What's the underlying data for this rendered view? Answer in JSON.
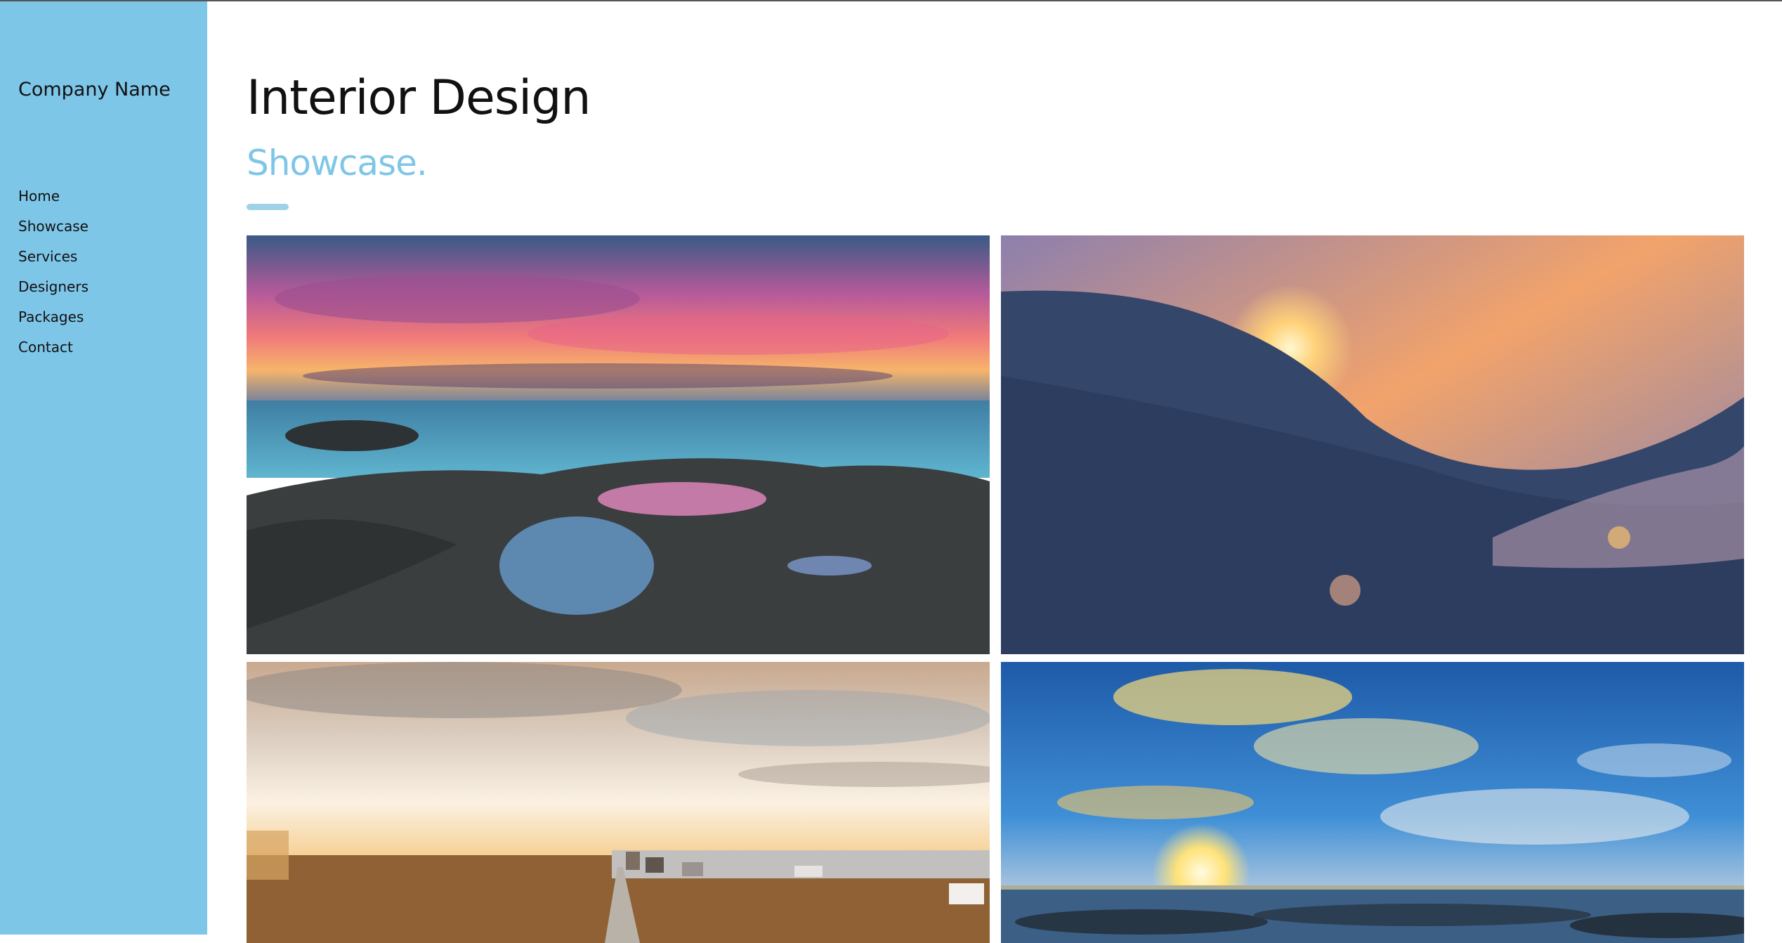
{
  "sidebar": {
    "company_name": "Company Name",
    "nav": [
      {
        "label": "Home"
      },
      {
        "label": "Showcase"
      },
      {
        "label": "Services"
      },
      {
        "label": "Designers"
      },
      {
        "label": "Packages"
      },
      {
        "label": "Contact"
      }
    ]
  },
  "main": {
    "title": "Interior Design",
    "subtitle": "Showcase."
  },
  "gallery": [
    {
      "subject": "rocky coast sunset"
    },
    {
      "subject": "ocean wave sunrise"
    },
    {
      "subject": "city aerial sunrise"
    },
    {
      "subject": "sea sunset blue sky"
    }
  ],
  "colors": {
    "sidebar": "#7ec6e8",
    "accent": "#7ec6e8",
    "text": "#111111"
  }
}
